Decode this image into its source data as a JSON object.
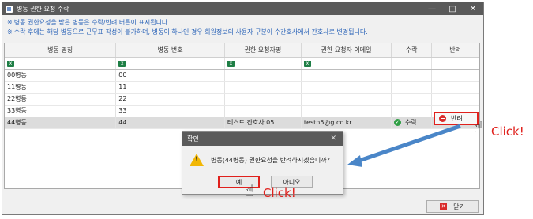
{
  "window": {
    "title": "병동 권한 요청 수락",
    "minimize": "—",
    "maximize": "□",
    "close": "✕"
  },
  "notes": [
    "병동 권한요청을 받은 병동은 수락/반려 버튼이 표시됩니다.",
    "수락 후에는 해당 병동으로 근무표 작성이 불가하며, 병동이 하나인 경우 회원정보의 사용자 구분이 수간호사에서 간호사로 변경됩니다."
  ],
  "note_mark": "※",
  "table": {
    "headers": [
      "병동 명칭",
      "병동 번호",
      "권한 요청자명",
      "권한 요청자 이메일",
      "수락",
      "반려"
    ],
    "rows": [
      {
        "name": "00병동",
        "code": "00",
        "requester": "",
        "email": "",
        "accept": "",
        "reject": ""
      },
      {
        "name": "11병동",
        "code": "11",
        "requester": "",
        "email": "",
        "accept": "",
        "reject": ""
      },
      {
        "name": "22병동",
        "code": "22",
        "requester": "",
        "email": "",
        "accept": "",
        "reject": ""
      },
      {
        "name": "33병동",
        "code": "33",
        "requester": "",
        "email": "",
        "accept": "",
        "reject": ""
      },
      {
        "name": "44병동",
        "code": "44",
        "requester": "테스트 간호사 05",
        "email": "testn5@g.co.kr",
        "accept": "수락",
        "reject": "반려"
      }
    ]
  },
  "close_button": "닫기",
  "dialog": {
    "title": "확인",
    "message": "병동(44병동) 권한요청을 반려하시겠습니까?",
    "yes": "예",
    "no": "아니오"
  },
  "annotations": {
    "click_text": "Click!"
  },
  "colors": {
    "highlight_red": "#e0201c",
    "arrow_blue": "#4a86c8",
    "note_blue": "#2a63b8"
  },
  "icons": {
    "check": "check-circle-icon",
    "reject": "minus-circle-icon",
    "warning": "warning-icon",
    "excel": "excel-icon",
    "hand": "hand-pointer-icon"
  }
}
